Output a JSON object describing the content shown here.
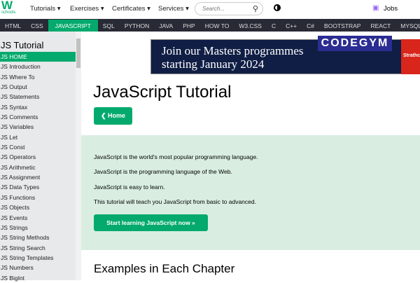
{
  "header": {
    "logo_top": "W",
    "logo_sup": "3",
    "logo_sub": "schools",
    "menus": [
      "Tutorials ▾",
      "Exercises ▾",
      "Certificates ▾",
      "Services ▾"
    ],
    "search_placeholder": "Search...",
    "jobs": "Jobs"
  },
  "nav": [
    "HTML",
    "CSS",
    "JAVASCRIPT",
    "SQL",
    "PYTHON",
    "JAVA",
    "PHP",
    "HOW TO",
    "W3.CSS",
    "C",
    "C++",
    "C#",
    "BOOTSTRAP",
    "REACT",
    "MYSQL"
  ],
  "sidebar": {
    "title": "JS Tutorial",
    "items": [
      "JS HOME",
      "JS Introduction",
      "JS Where To",
      "JS Output",
      "JS Statements",
      "JS Syntax",
      "JS Comments",
      "JS Variables",
      "JS Let",
      "JS Const",
      "JS Operators",
      "JS Arithmetic",
      "JS Assignment",
      "JS Data Types",
      "JS Functions",
      "JS Objects",
      "JS Events",
      "JS Strings",
      "JS String Methods",
      "JS String Search",
      "JS String Templates",
      "JS Numbers",
      "JS BigInt"
    ]
  },
  "ad": {
    "line1": "Join our Masters programmes",
    "line2": "starting January 2024",
    "codegym": "CODEGYM",
    "strath": "Strathclyde"
  },
  "main": {
    "title": "JavaScript Tutorial",
    "home_button": "❮ Home",
    "intro": [
      "JavaScript is the world's most popular programming language.",
      "JavaScript is the programming language of the Web.",
      "JavaScript is easy to learn.",
      "This tutorial will teach you JavaScript from basic to advanced."
    ],
    "start_button": "Start learning JavaScript now »",
    "section_title": "Examples in Each Chapter"
  },
  "colors": {
    "accent": "#04AA6D",
    "nav_bg": "#282A35",
    "intro_bg": "#D9EEE1"
  }
}
